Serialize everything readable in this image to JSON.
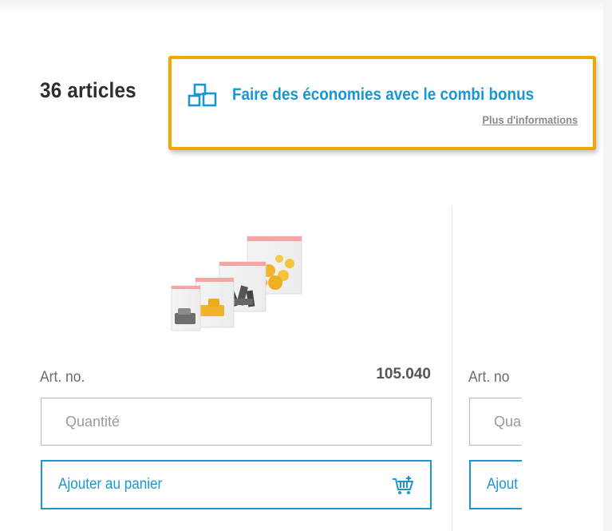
{
  "results": {
    "count_label": "36 articles"
  },
  "promo": {
    "title": "Faire des économies avec le combi bonus",
    "link_label": "Plus d'informations",
    "icon": "combi-squares-icon"
  },
  "products": [
    {
      "art_no_label": "Art. no.",
      "art_no_value": "105.040",
      "quantity_placeholder": "Quantité",
      "add_to_cart_label": "Ajouter au panier",
      "image": "resealable-bags-with-screws-and-dowels"
    },
    {
      "art_no_label": "Art. no",
      "quantity_placeholder": "Qua",
      "add_to_cart_label": "Ajout"
    }
  ],
  "colors": {
    "accent": "#1a96d4",
    "highlight_border": "#f2a600",
    "text_dark": "#2e2e2e",
    "text_muted": "#8b8b8b"
  }
}
